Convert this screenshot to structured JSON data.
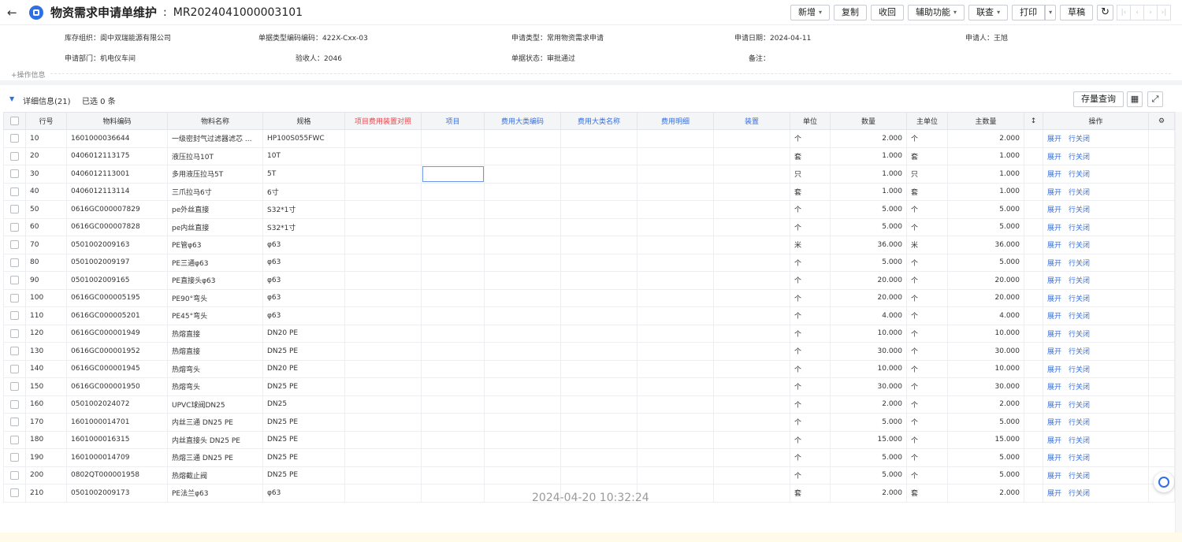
{
  "header": {
    "back_icon": "arrow-left-icon",
    "title": "物资需求申请单维护",
    "separator": ":",
    "bill_no": "MR2024041000003101",
    "buttons": {
      "add": "新增",
      "copy": "复制",
      "recall": "收回",
      "assist": "辅助功能",
      "linked_query": "联查",
      "print": "打印",
      "draft": "草稿"
    }
  },
  "info": {
    "org_label": "库存组织：",
    "org_value": "阆中双瑞能源有限公司",
    "bill_type_code_label": "单据类型编码编码：",
    "bill_type_code_value": "422X-Cxx-03",
    "apply_type_label": "申请类型：",
    "apply_type_value": "常用物资需求申请",
    "apply_date_label": "申请日期：",
    "apply_date_value": "2024-04-11",
    "applicant_label": "申请人：",
    "applicant_value": "王旭",
    "dept_label": "申请部门：",
    "dept_value": "机电仪车间",
    "receiver_label": "验收人：",
    "receiver_value": "2046",
    "status_label": "单据状态：",
    "status_value": "审批通过",
    "remark_label": "备注：",
    "remark_value": "",
    "ops_label": "+操作信息"
  },
  "detail": {
    "title": "详细信息(21)",
    "selected": "已选 0 条",
    "stock_query": "存量查询"
  },
  "columns": {
    "row_no": "行号",
    "material_code": "物料编码",
    "material_name": "物料名称",
    "spec": "规格",
    "project_fee_map": "项目费用装置对照",
    "project": "项目",
    "fee_class_code": "费用大类编码",
    "fee_class_name": "费用大类名称",
    "fee_detail": "费用明细",
    "device": "装置",
    "unit": "单位",
    "qty": "数量",
    "main_unit": "主单位",
    "main_qty": "主数量",
    "marker": "↕",
    "ops": "操作"
  },
  "row_actions": {
    "expand": "展开",
    "close": "行关闭"
  },
  "rows": [
    {
      "no": "10",
      "code": "1601000036644",
      "name": "一级密封气过滤器滤芯 ...",
      "spec": "HP100S055FWC",
      "unit": "个",
      "qty": "2.000",
      "main_unit": "个",
      "main_qty": "2.000"
    },
    {
      "no": "20",
      "code": "0406012113175",
      "name": "液压拉马10T",
      "spec": "10T",
      "unit": "套",
      "qty": "1.000",
      "main_unit": "套",
      "main_qty": "1.000"
    },
    {
      "no": "30",
      "code": "0406012113001",
      "name": "多用液压拉马5T",
      "spec": "5T",
      "unit": "只",
      "qty": "1.000",
      "main_unit": "只",
      "main_qty": "1.000"
    },
    {
      "no": "40",
      "code": "0406012113114",
      "name": "三爪拉马6寸",
      "spec": "6寸",
      "unit": "套",
      "qty": "1.000",
      "main_unit": "套",
      "main_qty": "1.000"
    },
    {
      "no": "50",
      "code": "0616GC000007829",
      "name": "pe外丝直接",
      "spec": "S32*1寸",
      "unit": "个",
      "qty": "5.000",
      "main_unit": "个",
      "main_qty": "5.000"
    },
    {
      "no": "60",
      "code": "0616GC000007828",
      "name": "pe内丝直接",
      "spec": "S32*1寸",
      "unit": "个",
      "qty": "5.000",
      "main_unit": "个",
      "main_qty": "5.000"
    },
    {
      "no": "70",
      "code": "0501002009163",
      "name": "PE管φ63",
      "spec": "φ63",
      "unit": "米",
      "qty": "36.000",
      "main_unit": "米",
      "main_qty": "36.000"
    },
    {
      "no": "80",
      "code": "0501002009197",
      "name": "PE三通φ63",
      "spec": "φ63",
      "unit": "个",
      "qty": "5.000",
      "main_unit": "个",
      "main_qty": "5.000"
    },
    {
      "no": "90",
      "code": "0501002009165",
      "name": "PE直接头φ63",
      "spec": "φ63",
      "unit": "个",
      "qty": "20.000",
      "main_unit": "个",
      "main_qty": "20.000"
    },
    {
      "no": "100",
      "code": "0616GC000005195",
      "name": "PE90°弯头",
      "spec": "φ63",
      "unit": "个",
      "qty": "20.000",
      "main_unit": "个",
      "main_qty": "20.000"
    },
    {
      "no": "110",
      "code": "0616GC000005201",
      "name": "PE45°弯头",
      "spec": "φ63",
      "unit": "个",
      "qty": "4.000",
      "main_unit": "个",
      "main_qty": "4.000"
    },
    {
      "no": "120",
      "code": "0616GC000001949",
      "name": "热熔直接",
      "spec": "DN20 PE",
      "unit": "个",
      "qty": "10.000",
      "main_unit": "个",
      "main_qty": "10.000"
    },
    {
      "no": "130",
      "code": "0616GC000001952",
      "name": "热熔直接",
      "spec": "DN25 PE",
      "unit": "个",
      "qty": "30.000",
      "main_unit": "个",
      "main_qty": "30.000"
    },
    {
      "no": "140",
      "code": "0616GC000001945",
      "name": "热熔弯头",
      "spec": "DN20 PE",
      "unit": "个",
      "qty": "10.000",
      "main_unit": "个",
      "main_qty": "10.000"
    },
    {
      "no": "150",
      "code": "0616GC000001950",
      "name": "热熔弯头",
      "spec": "DN25 PE",
      "unit": "个",
      "qty": "30.000",
      "main_unit": "个",
      "main_qty": "30.000"
    },
    {
      "no": "160",
      "code": "0501002024072",
      "name": "UPVC球阀DN25",
      "spec": "DN25",
      "unit": "个",
      "qty": "2.000",
      "main_unit": "个",
      "main_qty": "2.000"
    },
    {
      "no": "170",
      "code": "1601000014701",
      "name": "内丝三通 DN25 PE",
      "spec": "DN25 PE",
      "unit": "个",
      "qty": "5.000",
      "main_unit": "个",
      "main_qty": "5.000"
    },
    {
      "no": "180",
      "code": "1601000016315",
      "name": "内丝直接头 DN25 PE",
      "spec": "DN25 PE",
      "unit": "个",
      "qty": "15.000",
      "main_unit": "个",
      "main_qty": "15.000"
    },
    {
      "no": "190",
      "code": "1601000014709",
      "name": "热熔三通 DN25 PE",
      "spec": "DN25 PE",
      "unit": "个",
      "qty": "5.000",
      "main_unit": "个",
      "main_qty": "5.000"
    },
    {
      "no": "200",
      "code": "0802QT000001958",
      "name": "热熔截止阀",
      "spec": "DN25 PE",
      "unit": "个",
      "qty": "5.000",
      "main_unit": "个",
      "main_qty": "5.000"
    },
    {
      "no": "210",
      "code": "0501002009173",
      "name": "PE法兰φ63",
      "spec": "φ63",
      "unit": "套",
      "qty": "2.000",
      "main_unit": "套",
      "main_qty": "2.000"
    }
  ],
  "timestamp": "2024-04-20 10:32:24",
  "colors": {
    "accent": "#2f6fe4",
    "link": "#3a6fd8",
    "red_header": "#e5484d",
    "footer": "#fffbe8"
  }
}
